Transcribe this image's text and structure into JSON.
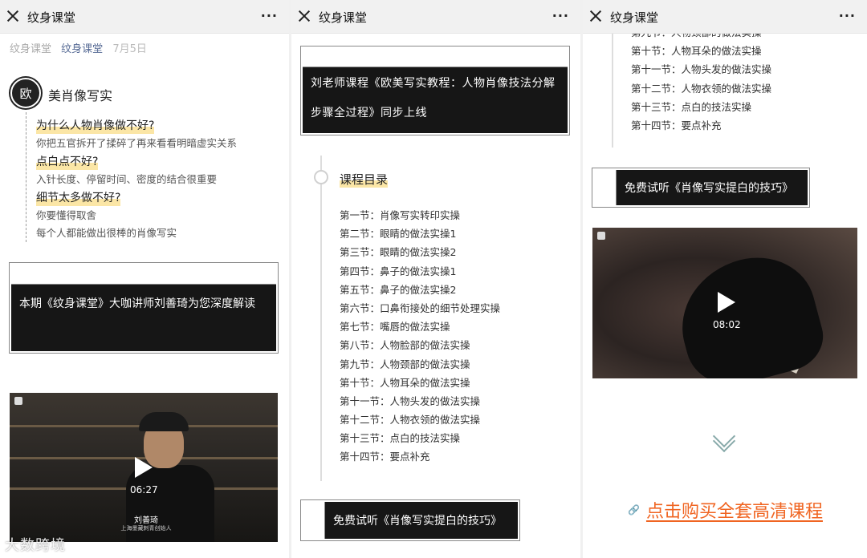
{
  "panels": [
    {
      "title": "纹身课堂",
      "more": "···"
    },
    {
      "title": "纹身课堂",
      "more": "···"
    },
    {
      "title": "纹身课堂",
      "more": "···"
    }
  ],
  "meta": {
    "account": "纹身课堂",
    "account_link": "纹身课堂",
    "date": "7月5日"
  },
  "section": {
    "badge": "欧",
    "title": "美肖像写实"
  },
  "qa": [
    {
      "q": "为什么人物肖像做不好?",
      "a": "你把五官拆开了揉碎了再来看看明暗虚实关系"
    },
    {
      "q": "点白点不好?",
      "a": "入针长度、停留时间、密度的结合很重要"
    },
    {
      "q": "细节太多做不好?",
      "a": "你要懂得取舍"
    }
  ],
  "qa_tail": "每个人都能做出很棒的肖像写实",
  "intro_box": "本期《纹身课堂》大咖讲师刘善琦为您深度解读",
  "video1": {
    "duration": "06:27",
    "name": "刘善琦",
    "subtitle": "上海墨藏刺青创始人"
  },
  "watermark": "大数跨境",
  "course_box": "刘老师课程《欧美写实教程：人物肖像技法分解步骤全过程》同步上线",
  "toc_title": "课程目录",
  "toc": [
    "第一节：肖像写实转印实操",
    "第二节：眼睛的做法实操1",
    "第三节：眼睛的做法实操2",
    "第四节：鼻子的做法实操1",
    "第五节：鼻子的做法实操2",
    "第六节：口鼻衔接处的细节处理实操",
    "第七节：嘴唇的做法实操",
    "第八节：人物脸部的做法实操",
    "第九节：人物颈部的做法实操",
    "第十节：人物耳朵的做法实操",
    "第十一节：人物头发的做法实操",
    "第十二节：人物衣领的做法实操",
    "第十三节：点白的技法实操",
    "第十四节：要点补充"
  ],
  "trial": "免费试听《肖像写实提白的技巧》",
  "video2": {
    "duration": "08:02"
  },
  "buy": "点击购买全套高清课程",
  "colors": {
    "highlight": "#fbe6a6",
    "link": "#576b95",
    "buy": "#f06522",
    "box": "#161616"
  }
}
